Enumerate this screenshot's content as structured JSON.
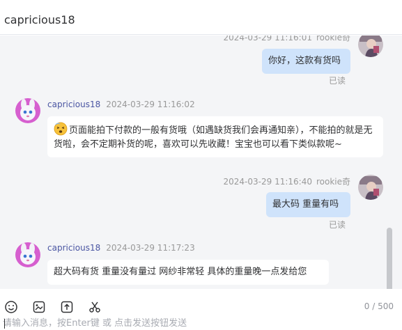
{
  "header": {
    "title": "capricious18"
  },
  "messages": [
    {
      "side": "right",
      "name": "rookie奇",
      "time": "2024-03-29 11:16:01",
      "text": "你好，这款有货吗",
      "status": "已读"
    },
    {
      "side": "left",
      "name": "capricious18",
      "time": "2024-03-29 11:16:02",
      "emoji": "dizzy-face-emoji",
      "text": "页面能拍下付款的一般有货哦（如遇缺货我们会再通知亲），不能拍的就是无货啦，会不定期补货的呢，喜欢可以先收藏！宝宝也可以看下类似款呢~"
    },
    {
      "side": "right",
      "name": "rookie奇",
      "time": "2024-03-29 11:16:40",
      "text": "最大码  重量有吗",
      "status": "已读"
    },
    {
      "side": "left",
      "name": "capricious18",
      "time": "2024-03-29 11:17:23",
      "text": "超大码有货 重量没有量过 网纱非常轻 具体的重量晚一点发给您"
    }
  ],
  "toolbar": {
    "icons": [
      "emoji-icon",
      "image-icon",
      "upload-icon",
      "scissors-icon"
    ],
    "counter": "0 / 500"
  },
  "input": {
    "placeholder": "请输入消息，按Enter键 或 点击发送按钮发送",
    "value": ""
  },
  "colors": {
    "mine_bubble": "#cfe3fb",
    "theirs_bubble": "#ffffff",
    "chat_bg": "#f4f5f7",
    "name_color": "#4a55a2"
  }
}
